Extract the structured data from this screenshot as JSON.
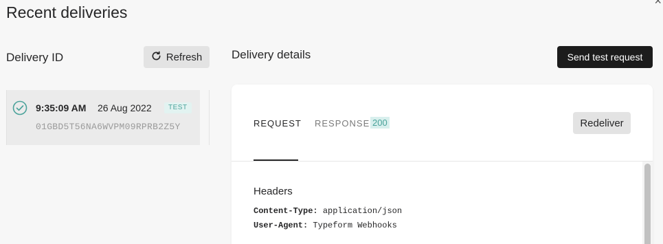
{
  "page": {
    "title": "Recent deliveries",
    "close_glyph": "×"
  },
  "deliveries": {
    "column_title": "Delivery ID",
    "refresh_label": "Refresh",
    "items": [
      {
        "time": "9:35:09 AM",
        "date": "26 Aug 2022",
        "badge": "TEST",
        "id": "01GBD5T56NA6WVPM09RPRB2Z5Y",
        "status_icon": "check-circle-icon"
      }
    ]
  },
  "details": {
    "title": "Delivery details",
    "send_test_label": "Send test request",
    "tabs": [
      {
        "label": "REQUEST",
        "active": true
      },
      {
        "label": "RESPONSE",
        "badge": "200"
      }
    ],
    "redeliver_label": "Redeliver",
    "headers_title": "Headers",
    "headers": [
      {
        "key": "Content-Type:",
        "value": "application/json"
      },
      {
        "key": "User-Agent:",
        "value": "Typeform Webhooks"
      }
    ]
  },
  "colors": {
    "accent_teal": "#4aa29a",
    "dark_button": "#1c1c1c",
    "light_button": "#e3e3e3"
  }
}
